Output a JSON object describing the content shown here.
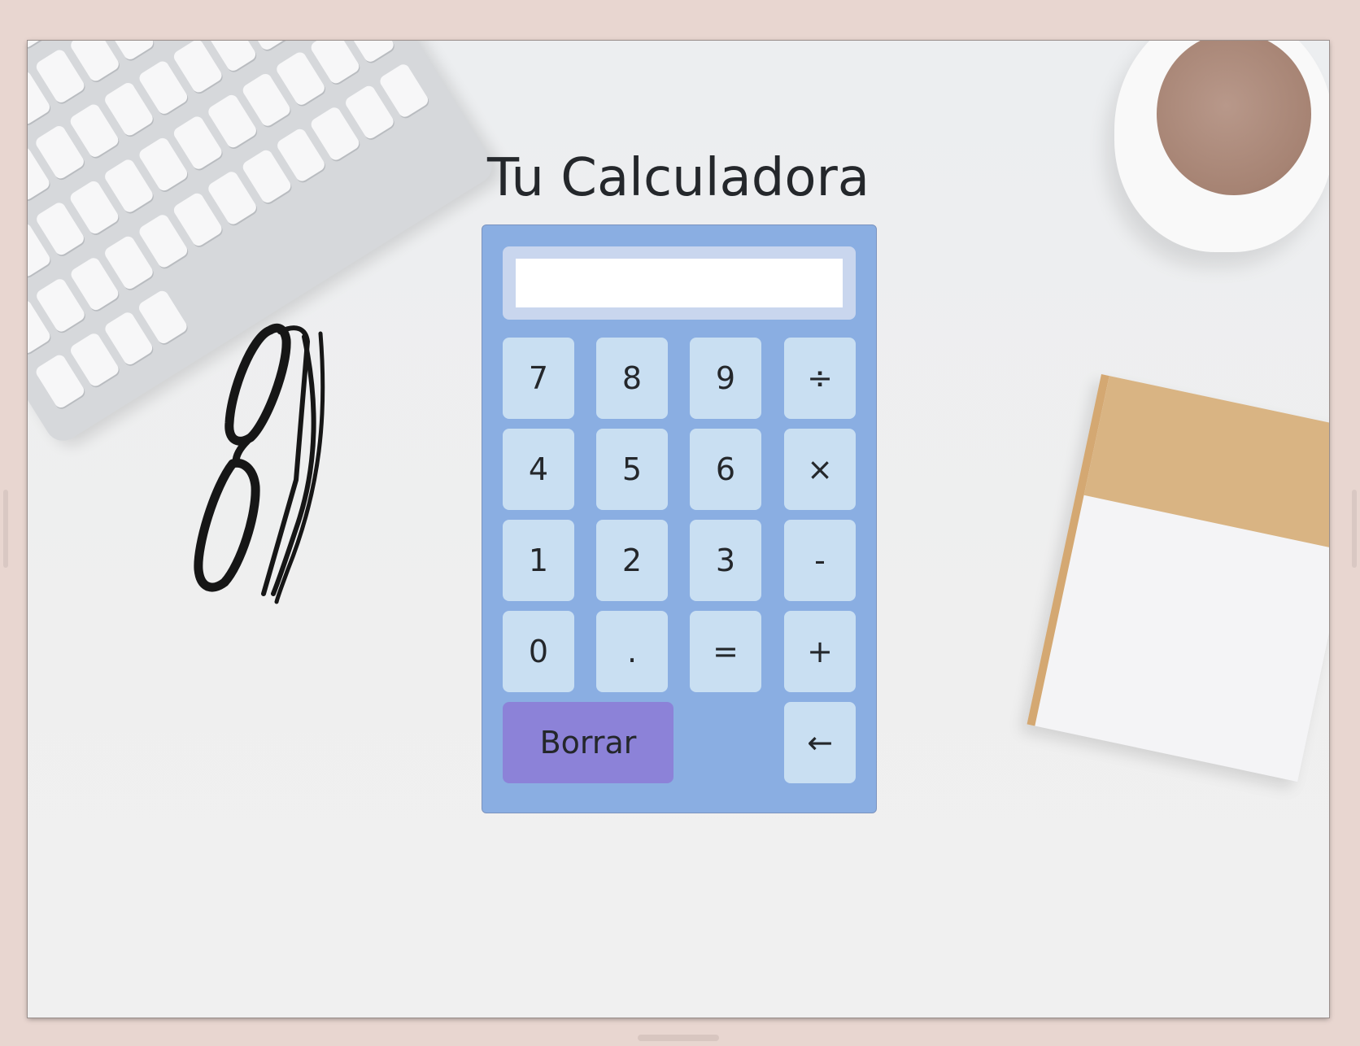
{
  "page": {
    "title": "Tu Calculadora"
  },
  "calculator": {
    "display_value": "",
    "rows": [
      [
        "7",
        "8",
        "9",
        "÷"
      ],
      [
        "4",
        "5",
        "6",
        "×"
      ],
      [
        "1",
        "2",
        "3",
        "-"
      ],
      [
        "0",
        ".",
        "=",
        "+"
      ]
    ],
    "clear_label": "Borrar",
    "backspace_label": "←"
  },
  "colors": {
    "calculator_bg": "#8aaee2",
    "button_bg": "#c9dff2",
    "clear_bg": "#8c82d8",
    "display_frame": "#c9d6ee"
  }
}
